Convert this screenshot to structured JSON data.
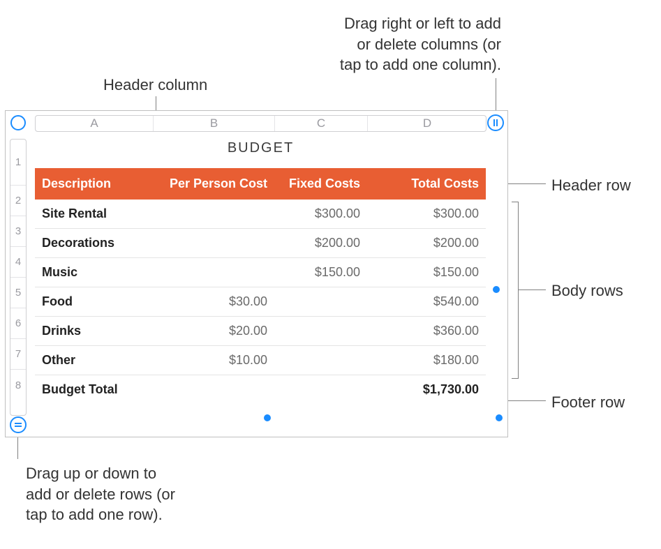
{
  "callouts": {
    "header_column": "Header column",
    "add_columns": "Drag right or left to add\nor delete columns (or\ntap to add one column).",
    "header_row": "Header row",
    "body_rows": "Body rows",
    "footer_row": "Footer row",
    "add_rows": "Drag up or down to\nadd or delete rows (or\ntap to add one row)."
  },
  "sheet": {
    "title": "BUDGET",
    "column_letters": [
      "A",
      "B",
      "C",
      "D"
    ],
    "row_numbers": [
      "1",
      "2",
      "3",
      "4",
      "5",
      "6",
      "7",
      "8"
    ],
    "headers": [
      "Description",
      "Per Person Cost",
      "Fixed Costs",
      "Total Costs"
    ],
    "rows": [
      {
        "desc": "Site Rental",
        "per": "",
        "fixed": "$300.00",
        "total": "$300.00"
      },
      {
        "desc": "Decorations",
        "per": "",
        "fixed": "$200.00",
        "total": "$200.00"
      },
      {
        "desc": "Music",
        "per": "",
        "fixed": "$150.00",
        "total": "$150.00"
      },
      {
        "desc": "Food",
        "per": "$30.00",
        "fixed": "",
        "total": "$540.00"
      },
      {
        "desc": "Drinks",
        "per": "$20.00",
        "fixed": "",
        "total": "$360.00"
      },
      {
        "desc": "Other",
        "per": "$10.00",
        "fixed": "",
        "total": "$180.00"
      }
    ],
    "footer": {
      "desc": "Budget Total",
      "per": "",
      "fixed": "",
      "total": "$1,730.00"
    }
  },
  "colors": {
    "accent": "#e85e33",
    "handle": "#1a8cff"
  }
}
